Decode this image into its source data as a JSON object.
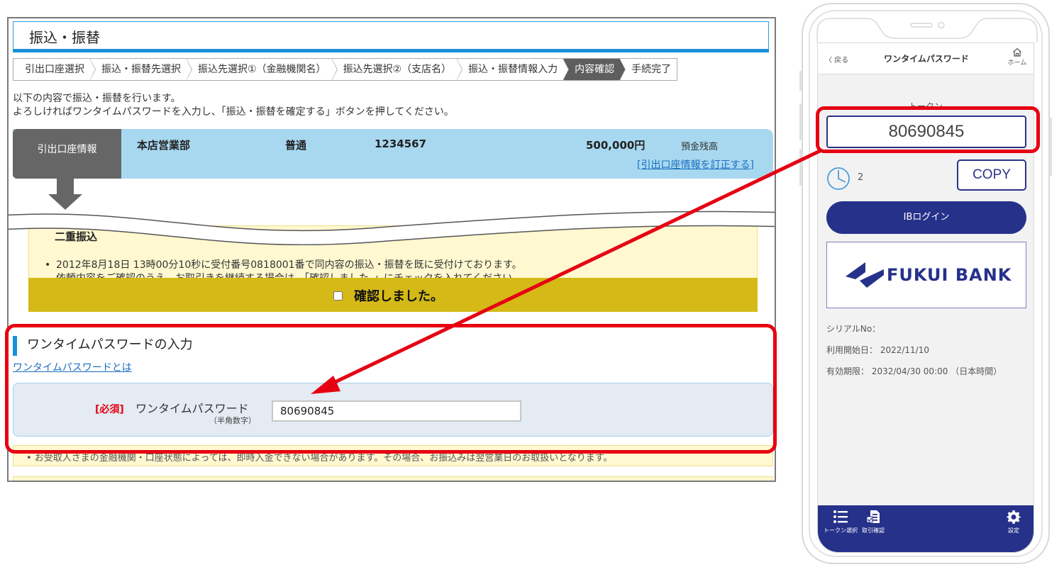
{
  "web": {
    "page_title": "振込・振替",
    "steps": [
      {
        "label": "引出口座選択",
        "active": false
      },
      {
        "label": "振込・振替先選択",
        "active": false
      },
      {
        "label": "振込先選択①（金融機関名）",
        "active": false
      },
      {
        "label": "振込先選択②（支店名）",
        "active": false
      },
      {
        "label": "振込・振替情報入力",
        "active": false
      },
      {
        "label": "内容確認",
        "active": true
      },
      {
        "label": "手続完了",
        "active": false
      }
    ],
    "intro_line1": "以下の内容で振込・振替を行います。",
    "intro_line2": "よろしければワンタイムパスワードを入力し、「振込・振替を確定する」ボタンを押してください。",
    "account": {
      "label": "引出口座情報",
      "branch": "本店営業部",
      "type": "普通",
      "number": "1234567",
      "balance": "500,000円",
      "balance_label": "預金残高",
      "edit_link": "[引出口座情報を訂正する]"
    },
    "duplicate": {
      "heading": "二重振込",
      "bullet": "•",
      "line1": "2012年8月18日 13時00分10秒に受付番号0818001番で同内容の振込・振替を既に受付けております。",
      "line2": "依頼内容をご確認のうえ、お取引きを継続する場合は、「確認しました。」にチェックを入れてください。",
      "confirm_label": "確認しました。",
      "confirm_checked": false
    },
    "otp": {
      "heading": "ワンタイムパスワードの入力",
      "help_link": "ワンタイムパスワードとは",
      "required": "[必須]",
      "label": "ワンタイムパスワード",
      "sub_label": "（半角数字）",
      "value": "80690845"
    },
    "note": "•  お受取人さまの金融機関・口座状態によっては、即時入金できない場合があります。その場合、お振込みは翌営業日のお取扱いとなります。"
  },
  "phone": {
    "nav": {
      "back": "〈 戻る",
      "title": "ワンタイムパスワード",
      "home": "ホーム"
    },
    "token_label": "トークン",
    "token_value": "80690845",
    "timer_seconds": "2",
    "copy_label": "COPY",
    "ib_login_label": "IBログイン",
    "bank_name": "FUKUI BANK",
    "serial_label": "シリアルNo：",
    "start_date": "利用開始日：  2022/11/10",
    "expiry": "有効期限：  2032/04/30 00:00 （日本時間）",
    "tabs": [
      {
        "label": "トークン選択",
        "icon": "list-icon"
      },
      {
        "label": "取引確認",
        "icon": "document-check-icon"
      },
      {
        "label": "設定",
        "icon": "gear-icon"
      }
    ]
  },
  "colors": {
    "accent_blue": "#1a8fdc",
    "navy": "#26318a",
    "highlight_red": "#e60012",
    "confirm_yellow": "#d4b917"
  }
}
